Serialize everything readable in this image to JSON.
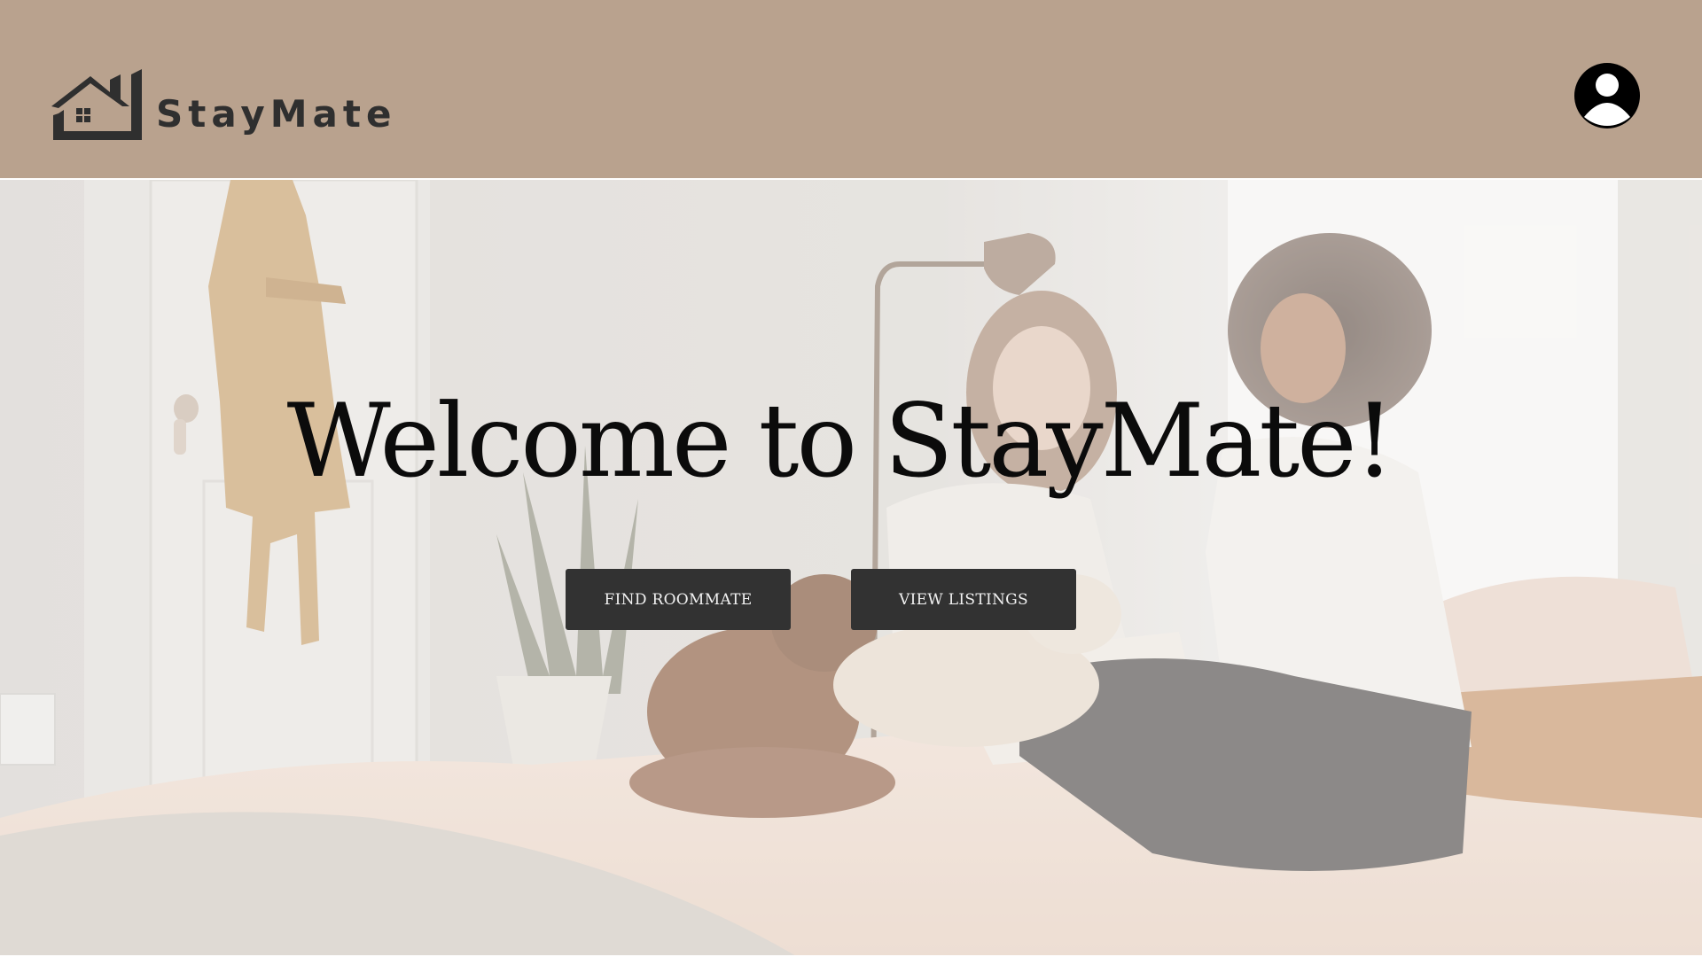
{
  "brand": {
    "name": "StayMate",
    "header_color": "#b9a28e",
    "logo_icon": "house-icon"
  },
  "header": {
    "profile_icon": "user-avatar-icon"
  },
  "hero": {
    "title": "Welcome to StayMate!",
    "background_image": "bedroom-photo with two women and dogs on a bed",
    "buttons": {
      "find_roommate_label": "FIND ROOMMATE",
      "view_listings_label": "VIEW LISTINGS",
      "button_color": "#323232"
    }
  }
}
